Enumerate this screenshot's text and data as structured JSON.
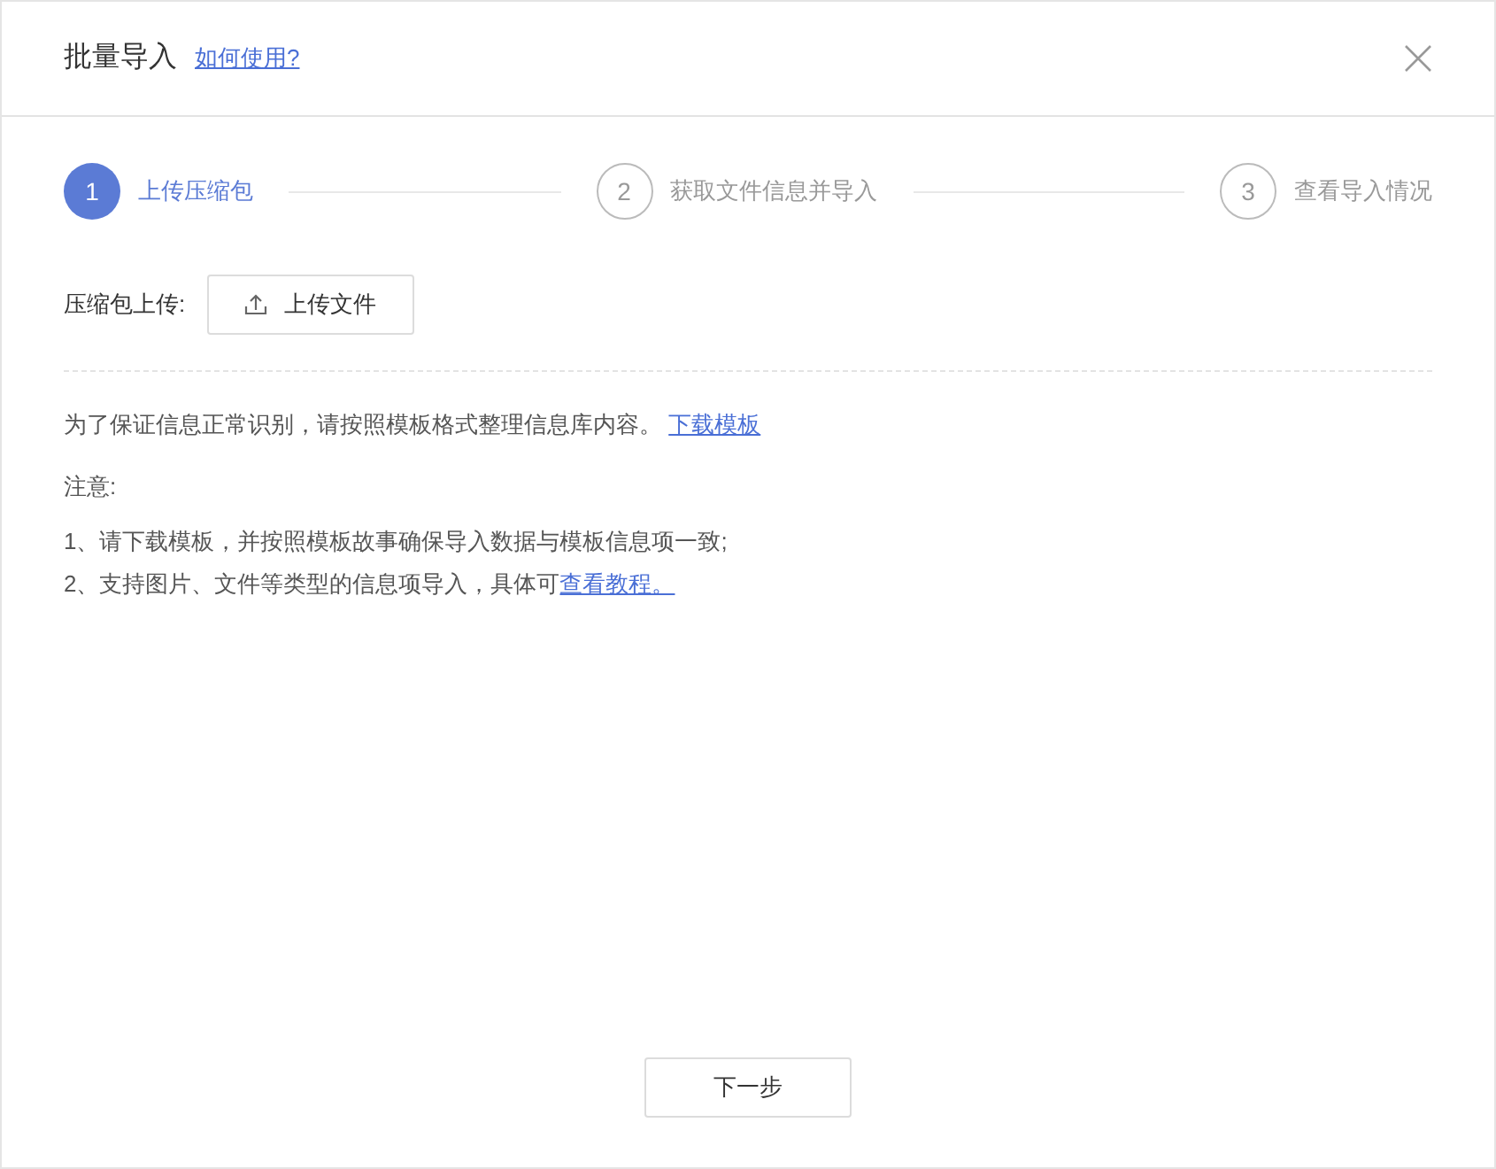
{
  "dialog": {
    "title": "批量导入",
    "help_link": "如何使用?"
  },
  "steps": [
    {
      "number": "1",
      "label": "上传压缩包",
      "selected": true
    },
    {
      "number": "2",
      "label": "获取文件信息并导入",
      "selected": false
    },
    {
      "number": "3",
      "label": "查看导入情况",
      "selected": false
    }
  ],
  "upload": {
    "label": "压缩包上传:",
    "button": "上传文件"
  },
  "info": {
    "text": "为了保证信息正常识别，请按照模板格式整理信息库内容。",
    "link": "下载模板"
  },
  "notes": {
    "title": "注意:",
    "items": [
      {
        "text": "1、请下载模板，并按照模板故事确保导入数据与模板信息项一致;"
      },
      {
        "text": "2、支持图片、文件等类型的信息项导入，具体可",
        "link": "查看教程。"
      }
    ]
  },
  "footer": {
    "next_button": "下一步"
  }
}
